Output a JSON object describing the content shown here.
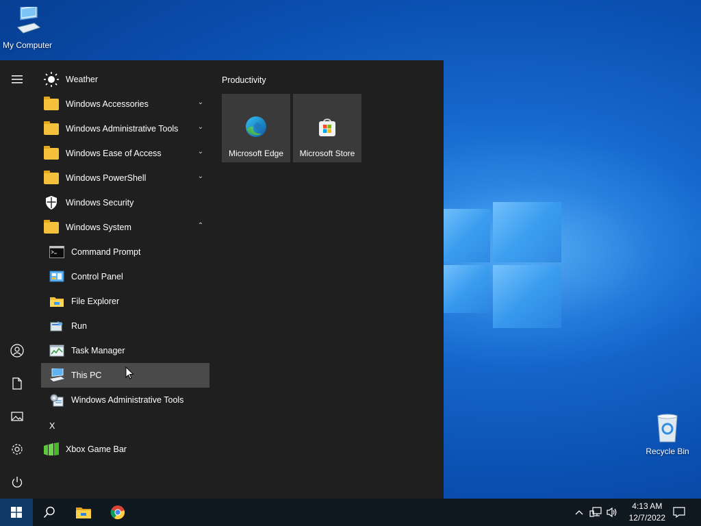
{
  "desktop": {
    "icons": [
      {
        "label": "My Computer"
      },
      {
        "label": "Recycle Bin"
      }
    ]
  },
  "start_menu": {
    "app_list": [
      {
        "label": "Weather",
        "icon": "weather-icon"
      },
      {
        "label": "Windows Accessories",
        "icon": "folder-icon",
        "expandable": true
      },
      {
        "label": "Windows Administrative Tools",
        "icon": "folder-icon",
        "expandable": true
      },
      {
        "label": "Windows Ease of Access",
        "icon": "folder-icon",
        "expandable": true
      },
      {
        "label": "Windows PowerShell",
        "icon": "folder-icon",
        "expandable": true
      },
      {
        "label": "Windows Security",
        "icon": "shield-icon"
      },
      {
        "label": "Windows System",
        "icon": "folder-icon",
        "expanded": true
      },
      {
        "label": "Command Prompt",
        "icon": "command-prompt-icon"
      },
      {
        "label": "Control Panel",
        "icon": "control-panel-icon"
      },
      {
        "label": "File Explorer",
        "icon": "file-explorer-icon"
      },
      {
        "label": "Run",
        "icon": "run-icon"
      },
      {
        "label": "Task Manager",
        "icon": "task-manager-icon"
      },
      {
        "label": "This PC",
        "icon": "this-pc-icon",
        "highlighted": true
      },
      {
        "label": "Windows Administrative Tools",
        "icon": "admin-tools-icon"
      }
    ],
    "letter_header": "X",
    "after_letter": [
      {
        "label": "Xbox Game Bar",
        "icon": "xbox-game-bar-icon"
      }
    ],
    "tile_group": {
      "title": "Productivity",
      "tiles": [
        {
          "label": "Microsoft Edge",
          "icon": "edge-icon"
        },
        {
          "label": "Microsoft Store",
          "icon": "store-icon"
        }
      ]
    },
    "rail": [
      "hamburger-menu-icon",
      "user-icon",
      "documents-icon",
      "pictures-icon",
      "settings-icon",
      "power-icon"
    ]
  },
  "taskbar": {
    "clock_time": "4:13 AM",
    "clock_date": "12/7/2022"
  },
  "colors": {
    "menu_bg": "#1f1f1f",
    "highlight": "#4a4a4a",
    "tile_bg": "#3a3a3a",
    "taskbar_bg": "#101820",
    "accent": "#0078d7"
  }
}
